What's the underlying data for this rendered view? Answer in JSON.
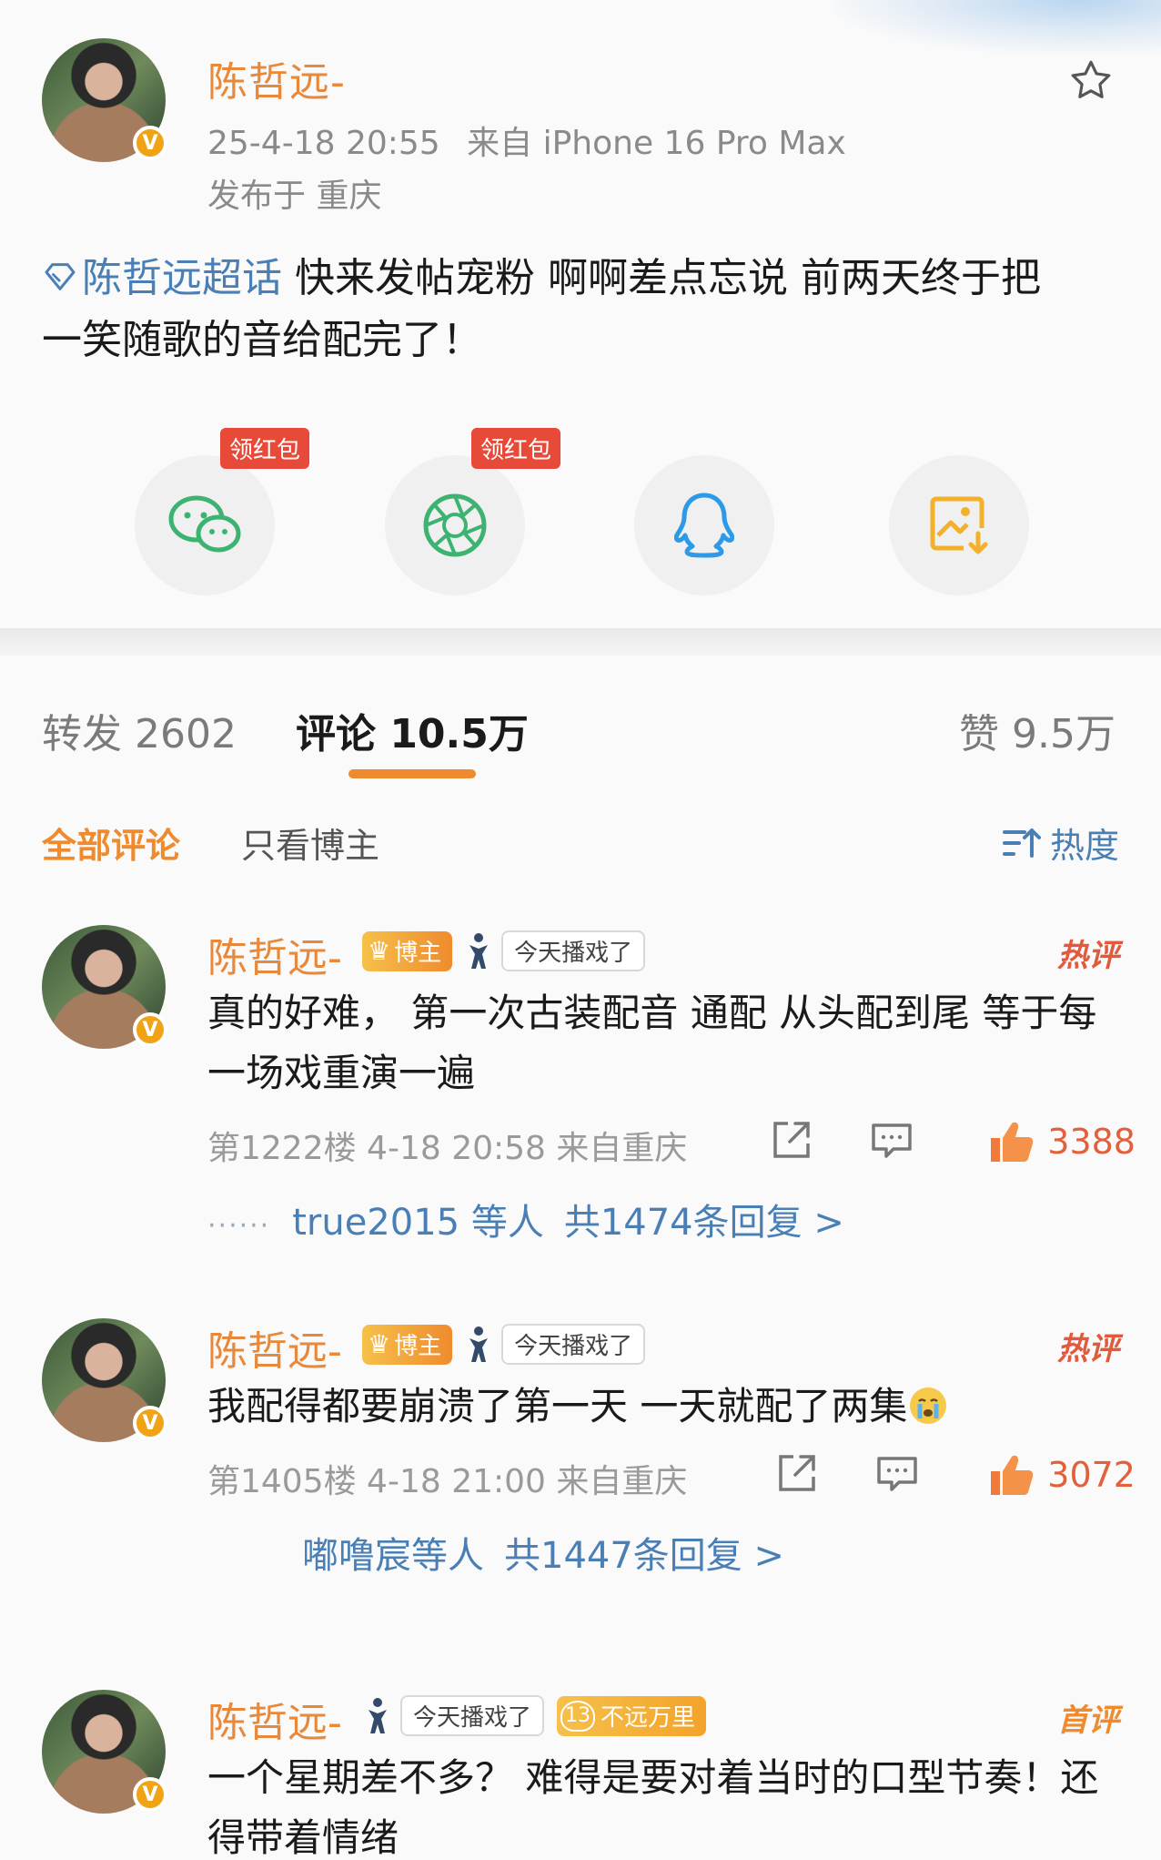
{
  "post": {
    "author": "陈哲远-",
    "timestamp": "25-4-18 20:55",
    "source": "来自 iPhone 16 Pro Max",
    "location": "发布于 重庆",
    "topic": "陈哲远超话",
    "text_line1": " 快来发帖宠粉 啊啊差点忘说 前两天终于把",
    "text_line2": "一笑随歌的音给配完了！"
  },
  "share": {
    "wechat_tag": "领红包",
    "moments_tag": "领红包"
  },
  "tabs": {
    "repost": "转发 2602",
    "comments": "评论 10.5万",
    "likes": "赞 9.5万"
  },
  "filter": {
    "all": "全部评论",
    "author_only": "只看博主",
    "sort": "热度"
  },
  "badges": {
    "blogger": "博主",
    "played": "今天播戏了",
    "level_num": "13",
    "level_text": "不远万里"
  },
  "comments": [
    {
      "name": "陈哲远-",
      "tag": "热评",
      "text_line1": "真的好难， 第一次古装配音 通配 从头配到尾 等于每",
      "text_line2": "一场戏重演一遍",
      "floor": "第1222楼 4-18 20:58 来自重庆",
      "likes": "3388",
      "reply_users": "true2015 等人",
      "reply_count": "共1474条回复 >"
    },
    {
      "name": "陈哲远-",
      "tag": "热评",
      "text_line1": "我配得都要崩溃了第一天 一天就配了两集",
      "floor": "第1405楼 4-18 21:00 来自重庆",
      "likes": "3072",
      "reply_users": "嘟噜宸等人",
      "reply_count": "共1447条回复 >"
    },
    {
      "name": "陈哲远-",
      "tag": "首评",
      "text_line1": "一个星期差不多？ 难得是要对着当时的口型节奏！还",
      "text_line2": "得带着情绪"
    }
  ],
  "colors": {
    "accent_orange": "#e8893a",
    "link_blue": "#4a7fb5",
    "hot_red": "#e25a3c"
  }
}
